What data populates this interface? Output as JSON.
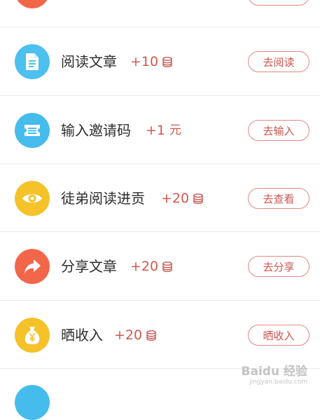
{
  "tasks": [
    {
      "title": "阅读文章",
      "reward": "+10",
      "unit_icon": "coin-stack-icon",
      "unit_text": "",
      "button": "去阅读",
      "icon": "document-icon",
      "color": "#4cc0ef"
    },
    {
      "title": "输入邀请码",
      "reward": "+1",
      "unit_icon": "",
      "unit_text": "元",
      "button": "去输入",
      "icon": "ticket-icon",
      "color": "#45bcec"
    },
    {
      "title": "徒弟阅读进贡",
      "reward": "+20",
      "unit_icon": "coin-stack-icon",
      "unit_text": "",
      "button": "去查看",
      "icon": "eye-icon",
      "color": "#f6c22a"
    },
    {
      "title": "分享文章",
      "reward": "+20",
      "unit_icon": "coin-stack-icon",
      "unit_text": "",
      "button": "去分享",
      "icon": "share-arrow-icon",
      "color": "#f2664a"
    },
    {
      "title": "晒收入",
      "reward": "+20",
      "unit_icon": "coin-stack-icon",
      "unit_text": "",
      "button": "晒收入",
      "icon": "money-bag-icon",
      "color": "#f6c22a"
    }
  ],
  "watermark": {
    "line1": "Baidu 经验",
    "line2": "jingyan.baidu.com"
  },
  "colors": {
    "reward": "#d2584f",
    "button_border": "#dc8a84",
    "button_text": "#c9564d",
    "divider": "#ececec",
    "partial_top_icon": "#f2664a",
    "partial_bottom_icon": "#45bcec"
  }
}
